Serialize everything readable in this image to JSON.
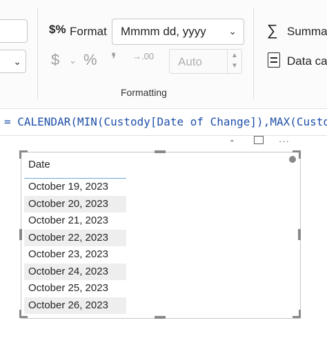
{
  "ribbon": {
    "format_icon": "$%",
    "format_label": "Format",
    "format_value": "Mmmm dd, yyyy",
    "currency_icon": "$",
    "percent_icon": "%",
    "comma_icon": "❜",
    "decimals_icon": ".00",
    "auto_value": "Auto",
    "group_label": "Formatting",
    "summarization_icon": "sigma-icon",
    "summarization_label": "Summa",
    "summarization_glyph": "∑",
    "data_category_label": "Data ca"
  },
  "formula": {
    "text": "= CALENDAR(MIN(Custody[Date of Change]),MAX(Custo"
  },
  "table": {
    "header": "Date",
    "rows": [
      "October 19, 2023",
      "October 20, 2023",
      "October 21, 2023",
      "October 22, 2023",
      "October 23, 2023",
      "October 24, 2023",
      "October 25, 2023",
      "October 26, 2023"
    ]
  }
}
